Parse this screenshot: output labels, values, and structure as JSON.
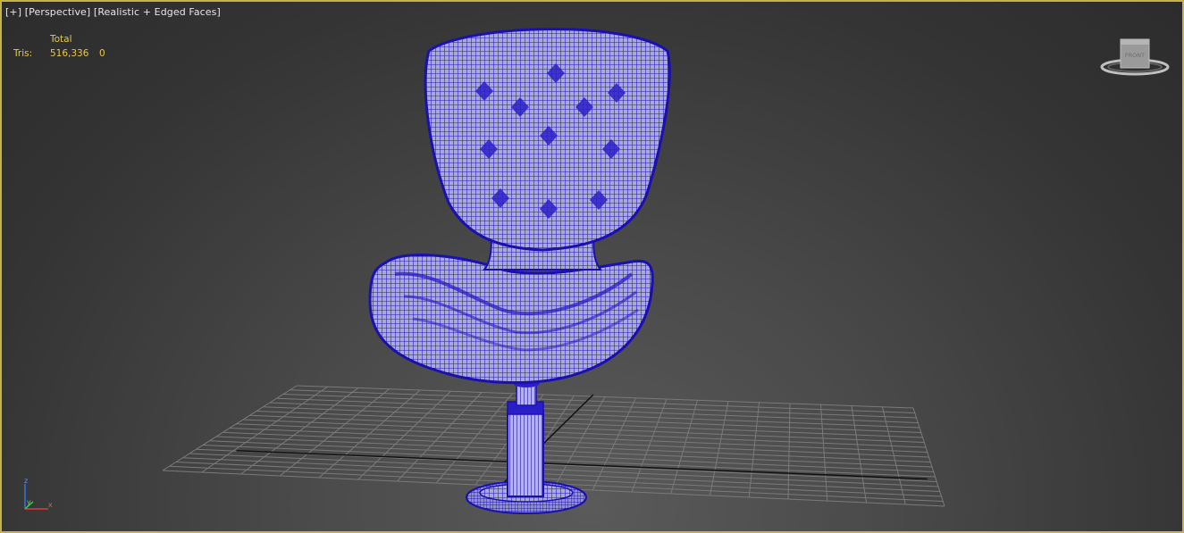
{
  "viewport": {
    "label_plus": "[+]",
    "label_view": "[Perspective]",
    "label_shading": "[Realistic + Edged Faces]",
    "border_color": "#c8b04a"
  },
  "stats": {
    "header": "Total",
    "rows": [
      {
        "label": "Tris:",
        "total": "516,336",
        "selected": "0"
      }
    ],
    "text_color": "#e8c84a"
  },
  "viewcube": {
    "face_label": "FRONT"
  },
  "axis_tripod": {
    "x_label": "x",
    "y_label": "y",
    "z_label": "z"
  },
  "model": {
    "wire_color": "#1e14c8",
    "surface_color": "#9a9ac8"
  }
}
